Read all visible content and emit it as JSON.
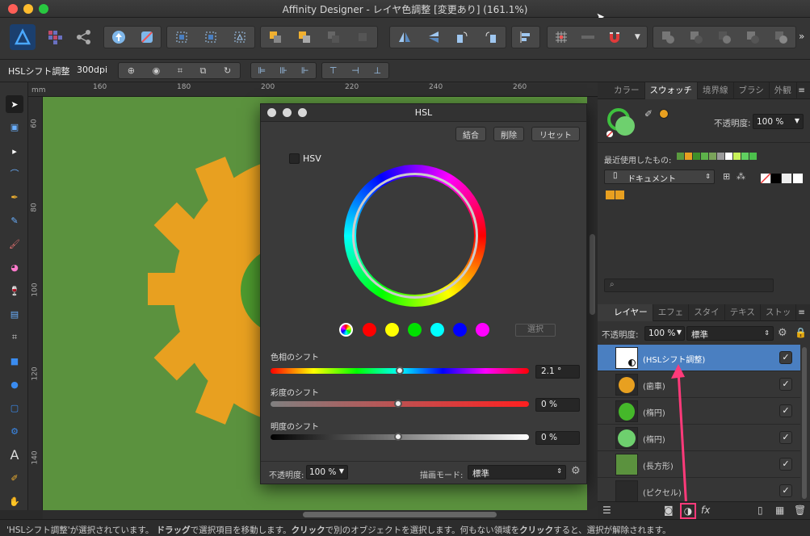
{
  "window": {
    "title": "Affinity Designer - レイヤ色調整 [変更あり] (161.1%)"
  },
  "context_bar": {
    "tool_label": "HSLシフト調整",
    "dpi": "300dpi"
  },
  "rulers": {
    "unit": "mm",
    "h_ticks": [
      "160",
      "180",
      "200",
      "220",
      "240",
      "260"
    ],
    "v_ticks": [
      "60",
      "80",
      "100",
      "120",
      "140"
    ]
  },
  "hsl_dialog": {
    "title": "HSL",
    "buttons": {
      "merge": "結合",
      "delete": "削除",
      "reset": "リセット"
    },
    "hsv_label": "HSV",
    "select_button": "選択",
    "hue": {
      "label": "色相のシフト",
      "value": "2.1 °",
      "level": 0.506
    },
    "saturation": {
      "label": "彩度のシフト",
      "value": "0 %",
      "level": 0.5
    },
    "lightness": {
      "label": "明度のシフト",
      "value": "0 %",
      "level": 0.5
    },
    "opacity_label": "不透明度:",
    "opacity_value": "100 %",
    "blend_label": "描画モード:",
    "blend_value": "標準",
    "color_dots": [
      "#ff0000",
      "#ffff00",
      "#00e000",
      "#00ffff",
      "#0000ff",
      "#ff00ff"
    ]
  },
  "swatches_panel": {
    "tabs": [
      "カラー",
      "スウォッチ",
      "境界線",
      "ブラシ",
      "外観"
    ],
    "active_tab": "スウォッチ",
    "opacity_label": "不透明度:",
    "opacity_value": "100 %",
    "recent_label": "最近使用したもの:",
    "recent_colors": [
      "#5a9a3f",
      "#e8a020",
      "#3e8f2a",
      "#5db34a",
      "#7aa35a",
      "#9b9b9b",
      "#ffffff",
      "#c8f25a",
      "#60d060",
      "#4cc04c"
    ],
    "palette_select": "ドキュメント",
    "doc_colors": [
      "#e8a020",
      "#e8a020"
    ]
  },
  "layers_panel": {
    "tabs": [
      "レイヤー",
      "エフェ",
      "スタイ",
      "テキス",
      "ストッ"
    ],
    "active_tab": "レイヤー",
    "opacity_label": "不透明度:",
    "opacity_value": "100 %",
    "blend_value": "標準",
    "layers": [
      {
        "name": "(HSLシフト調整)",
        "selected": true
      },
      {
        "name": "(歯車)",
        "selected": false
      },
      {
        "name": "(楕円)",
        "selected": false
      },
      {
        "name": "(楕円)",
        "selected": false
      },
      {
        "name": "(長方形)",
        "selected": false
      },
      {
        "name": "(ピクセル)",
        "selected": false
      }
    ],
    "fx_label": "fx"
  },
  "status": {
    "part1": "'HSLシフト調整'が選択されています。",
    "drag": "ドラッグ",
    "part2": "で選択項目を移動します。",
    "click": "クリック",
    "part3": "で別のオブジェクトを選択します。何もない領域を",
    "click2": "クリック",
    "part4": "すると、選択が解除されます。"
  },
  "colors": {
    "accent": "#4a7fc1",
    "canvas": "#5b923e",
    "gear": "#e8a020",
    "annotation": "#ff3a7a"
  }
}
